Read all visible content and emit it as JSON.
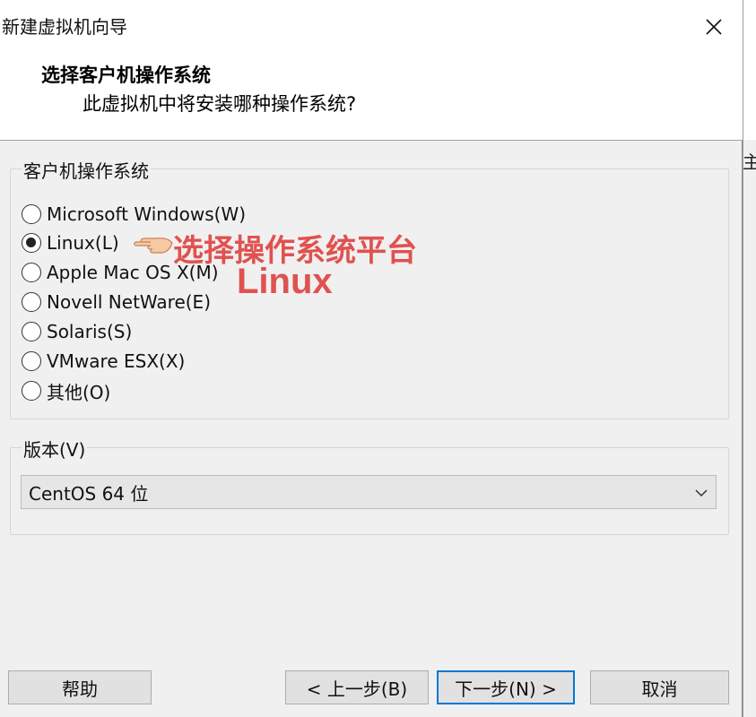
{
  "window": {
    "title": "新建虚拟机向导",
    "close_symbol": "✕"
  },
  "header": {
    "title": "选择客户机操作系统",
    "subtitle": "此虚拟机中将安装哪种操作系统?"
  },
  "guest_os_group": {
    "label": "客户机操作系统",
    "options": [
      {
        "label": "Microsoft Windows(W)",
        "checked": false
      },
      {
        "label": "Linux(L)",
        "checked": true
      },
      {
        "label": "Apple Mac OS X(M)",
        "checked": false
      },
      {
        "label": "Novell NetWare(E)",
        "checked": false
      },
      {
        "label": "Solaris(S)",
        "checked": false
      },
      {
        "label": "VMware ESX(X)",
        "checked": false
      },
      {
        "label": "其他(O)",
        "checked": false
      }
    ]
  },
  "version_group": {
    "label": "版本(V)",
    "selected": "CentOS 64 位"
  },
  "annotation": {
    "line1": "选择操作系统平台",
    "line2": "Linux",
    "color": "#e0524f",
    "icon": "pointing-hand-icon"
  },
  "buttons": {
    "help": "帮助",
    "back": "< 上一步(B)",
    "next": "下一步(N) >",
    "cancel": "取消"
  },
  "background_window": {
    "partial_text": "主"
  }
}
